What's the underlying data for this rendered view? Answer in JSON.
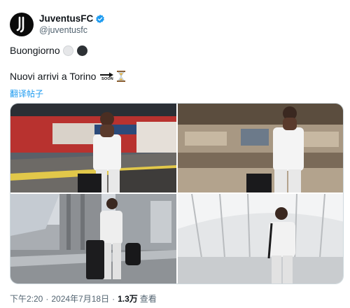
{
  "account": {
    "display_name": "JuventusFC",
    "handle": "@juventusfc",
    "verified": true,
    "avatar_icon": "juventus-logo-icon"
  },
  "tweet": {
    "line1": "Buongiorno",
    "line2": "Nuovi arrivi a Torino",
    "emoji": [
      "white-circle",
      "black-circle",
      "soon-arrow",
      "hourglass"
    ],
    "soon_label": "SOON",
    "translate_label": "翻译帖子"
  },
  "media": {
    "count": 4,
    "photos": [
      "photo-train-station-platform",
      "photo-station-hall",
      "photo-walking-with-luggage",
      "photo-glass-canopy-walkway"
    ]
  },
  "footer": {
    "time": "下午2:20",
    "date": "2024年7月18日",
    "views": "1.3万",
    "views_label": "查看"
  },
  "colors": {
    "accent": "#1d9bf0",
    "text": "#0f1419",
    "muted": "#536471"
  }
}
